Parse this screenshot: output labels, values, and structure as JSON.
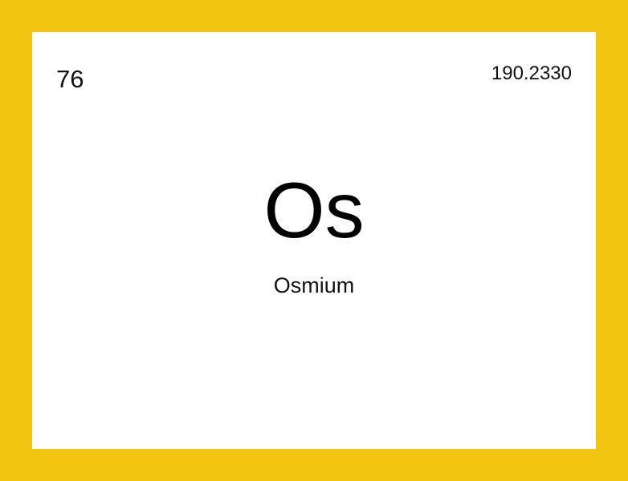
{
  "element": {
    "atomic_number": "76",
    "atomic_mass": "190.2330",
    "symbol": "Os",
    "name": "Osmium"
  },
  "colors": {
    "border": "#F2C511",
    "card": "#FFFFFF",
    "text": "#000000"
  }
}
